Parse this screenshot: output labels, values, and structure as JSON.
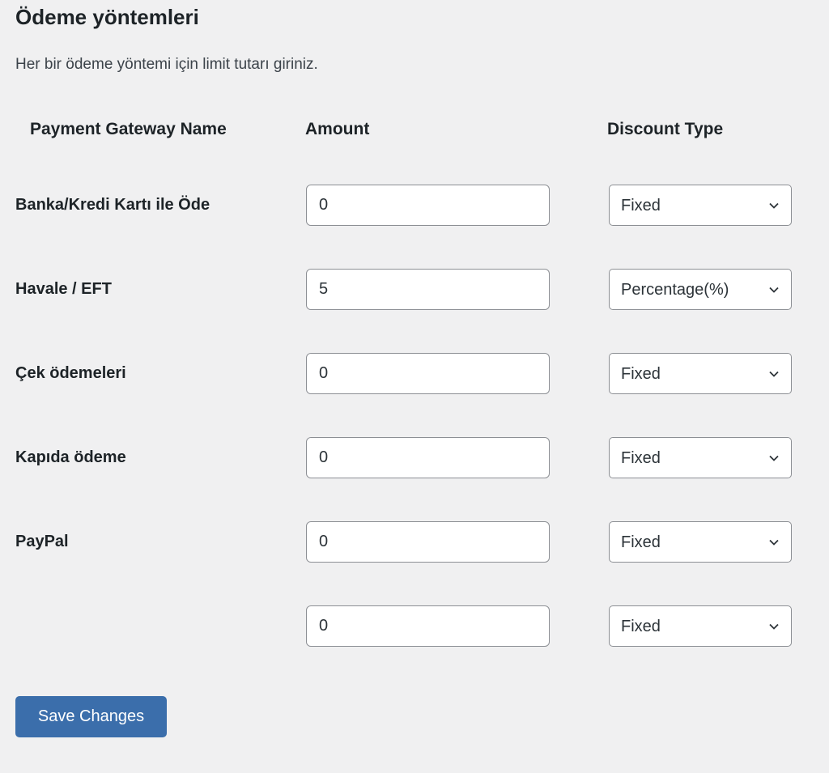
{
  "section": {
    "title": "Ödeme yöntemleri",
    "description": "Her bir ödeme yöntemi için limit tutarı giriniz."
  },
  "table": {
    "headers": {
      "name": "Payment Gateway Name",
      "amount": "Amount",
      "discount_type": "Discount Type"
    },
    "rows": [
      {
        "name": "Banka/Kredi Kartı ile Öde",
        "amount": "0",
        "discount_type": "Fixed"
      },
      {
        "name": "Havale / EFT",
        "amount": "5",
        "discount_type": "Percentage(%)"
      },
      {
        "name": "Çek ödemeleri",
        "amount": "0",
        "discount_type": "Fixed"
      },
      {
        "name": "Kapıda ödeme",
        "amount": "0",
        "discount_type": "Fixed"
      },
      {
        "name": "PayPal",
        "amount": "0",
        "discount_type": "Fixed"
      },
      {
        "name": "",
        "amount": "0",
        "discount_type": "Fixed"
      }
    ]
  },
  "actions": {
    "save_label": "Save Changes"
  },
  "colors": {
    "background": "#f0f0f1",
    "primary_button": "#3b6eab",
    "text": "#1d2327"
  }
}
